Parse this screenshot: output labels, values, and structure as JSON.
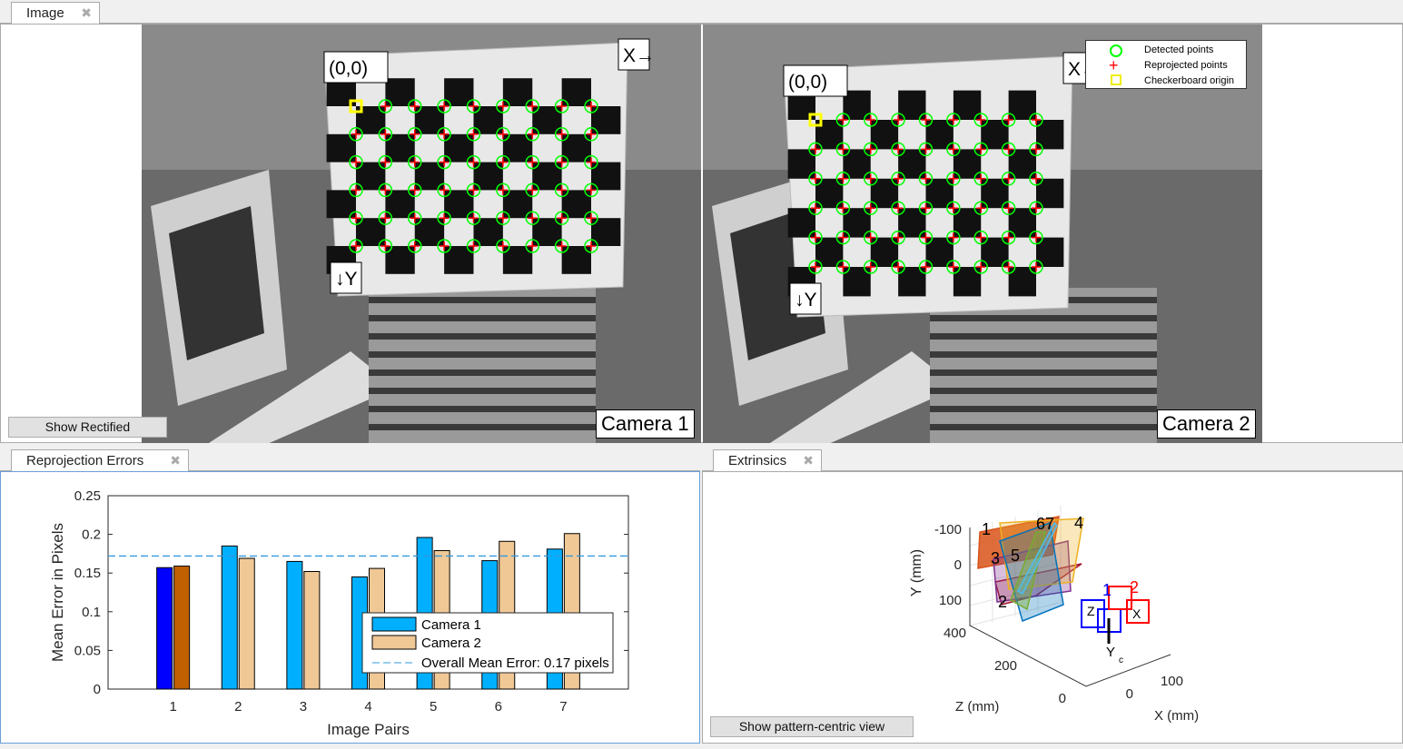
{
  "image_tab": {
    "label": "Image"
  },
  "image_panel": {
    "show_rectified": "Show Rectified",
    "camera1": "Camera 1",
    "camera2": "Camera 2",
    "origin_label": "(0,0)",
    "x_label": "X→",
    "y_label": "↓Y",
    "legend": [
      "Detected points",
      "Reprojected points",
      "Checkerboard origin"
    ],
    "colors": {
      "detected": "#00ff00",
      "reprojected": "#ff0000",
      "origin": "#ffff00"
    }
  },
  "reproj_tab": {
    "label": "Reprojection Errors"
  },
  "extr_tab": {
    "label": "Extrinsics",
    "button": "Show pattern-centric view",
    "y_label": "Y (mm)",
    "z_label": "Z (mm)",
    "x_label": "X (mm)",
    "y_ticks": [
      "-100",
      "0",
      "100"
    ],
    "z_ticks": [
      "400",
      "200",
      "0"
    ],
    "x_ticks": [
      "0",
      "100"
    ],
    "cam_axis_labels": [
      "Z",
      "X",
      "Y"
    ],
    "cam_axis_sub": "c",
    "board_ids": [
      "1",
      "2",
      "3",
      "4",
      "5",
      "6",
      "7"
    ],
    "cam_ids": [
      "1",
      "2"
    ]
  },
  "chart_data": {
    "type": "bar",
    "categories": [
      "1",
      "2",
      "3",
      "4",
      "5",
      "6",
      "7"
    ],
    "series": [
      {
        "name": "Camera 1",
        "values": [
          0.157,
          0.185,
          0.165,
          0.145,
          0.196,
          0.166,
          0.181
        ],
        "color": "#00b0ff"
      },
      {
        "name": "Camera 2",
        "values": [
          0.159,
          0.169,
          0.152,
          0.156,
          0.179,
          0.191,
          0.201
        ],
        "color": "#f0c896"
      }
    ],
    "highlight_colors": [
      "#0000ff",
      "#c06000"
    ],
    "mean_line": {
      "value": 0.172,
      "label": "Overall Mean Error: 0.17 pixels",
      "color": "#3399dd"
    },
    "xlabel": "Image Pairs",
    "ylabel": "Mean Error in Pixels",
    "ylim": [
      0,
      0.25
    ],
    "yticks": [
      "0",
      "0.05",
      "0.1",
      "0.15",
      "0.2",
      "0.25"
    ],
    "legend_position": "bottom-right"
  }
}
